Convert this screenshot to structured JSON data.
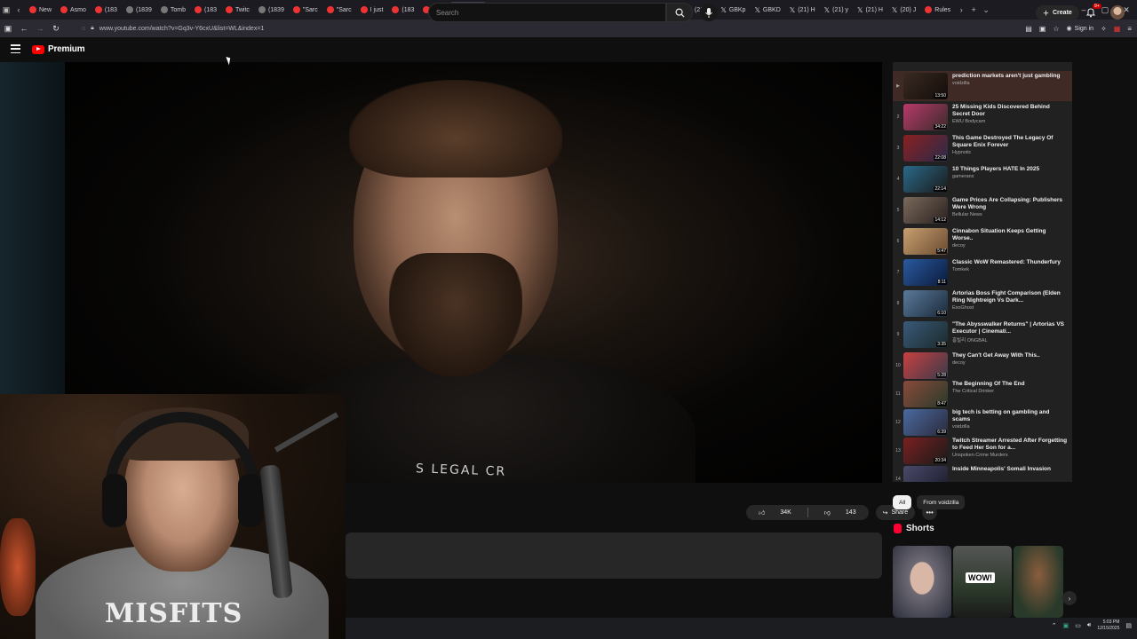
{
  "browser": {
    "tabs": [
      {
        "label": "New",
        "icon": "red"
      },
      {
        "label": "Asmo",
        "icon": "red"
      },
      {
        "label": "(183",
        "icon": "red"
      },
      {
        "label": "(1839",
        "icon": "gray"
      },
      {
        "label": "Tomb",
        "icon": "gray"
      },
      {
        "label": "(183",
        "icon": "red"
      },
      {
        "label": "Twitc",
        "icon": "red"
      },
      {
        "label": "(1839",
        "icon": "gray"
      },
      {
        "label": "\"Sarc",
        "icon": "red"
      },
      {
        "label": "\"Sarc",
        "icon": "red"
      },
      {
        "label": "I just",
        "icon": "red"
      },
      {
        "label": "(183",
        "icon": "red"
      },
      {
        "label": "(183",
        "icon": "red"
      },
      {
        "label": "(1)",
        "icon": "red",
        "active": true
      },
      {
        "label": "(183",
        "icon": "red"
      },
      {
        "label": "(183",
        "icon": "red"
      },
      {
        "label": "Hois",
        "icon": "red"
      },
      {
        "label": "(21) F",
        "icon": "x"
      },
      {
        "label": "(21) E",
        "icon": "x"
      },
      {
        "label": "(21) T",
        "icon": "x"
      },
      {
        "label": "(21) H",
        "icon": "x"
      },
      {
        "label": "GBKp",
        "icon": "x"
      },
      {
        "label": "GBKD",
        "icon": "x"
      },
      {
        "label": "(21) H",
        "icon": "x"
      },
      {
        "label": "(21) y",
        "icon": "x"
      },
      {
        "label": "(21) H",
        "icon": "x"
      },
      {
        "label": "(20) J",
        "icon": "x"
      },
      {
        "label": "Rules",
        "icon": "red"
      }
    ],
    "url": "www.youtube.com/watch?v=Gq3v-Y6cxU&list=WL&index=1",
    "signin": "Sign in"
  },
  "youtube": {
    "logo": "Premium",
    "search_placeholder": "Search",
    "create_label": "Create",
    "notif_badge": "9+"
  },
  "video": {
    "shirt_text": "S LEGAL CR",
    "likes": "34K",
    "dislikes": "143",
    "share_label": "Share"
  },
  "webcam": {
    "shirt_text": "MISFITS"
  },
  "playlist": {
    "items": [
      {
        "index": "▶",
        "title": "prediction markets aren't just gambling",
        "channel": "voidzilla",
        "duration": "13:50",
        "current": true
      },
      {
        "index": "2",
        "title": "25 Missing Kids Discovered Behind Secret Door",
        "channel": "EWU Bodycam",
        "duration": "34:22"
      },
      {
        "index": "3",
        "title": "This Game Destroyed The Legacy Of Square Enix Forever",
        "channel": "Hypnotic",
        "duration": "22:08"
      },
      {
        "index": "4",
        "title": "10 Things Players HATE In 2025",
        "channel": "gameranx",
        "duration": "22:14"
      },
      {
        "index": "5",
        "title": "Game Prices Are Collapsing: Publishers Were Wrong",
        "channel": "Bellular News",
        "duration": "14:12"
      },
      {
        "index": "6",
        "title": "Cinnabon Situation Keeps Getting Worse..",
        "channel": "decoy",
        "duration": "5:47"
      },
      {
        "index": "7",
        "title": "Classic WoW Remastered: Thunderfury",
        "channel": "Tomkek",
        "duration": "8:11"
      },
      {
        "index": "8",
        "title": "Artorias Boss Fight Comparison (Elden Ring Nightreign Vs Dark...",
        "channel": "ExoGhost",
        "duration": "6:10"
      },
      {
        "index": "9",
        "title": "\"The Abysswalker Returns\" | Artorias VS Executor | Cinemati...",
        "channel": "흥빌리 ONGBAL",
        "duration": "3:35"
      },
      {
        "index": "10",
        "title": "They Can't Get Away With This..",
        "channel": "decoy",
        "duration": "5:28"
      },
      {
        "index": "11",
        "title": "The Beginning Of The End",
        "channel": "The Critical Drinker",
        "duration": "8:47"
      },
      {
        "index": "12",
        "title": "big tech is betting on gambling and scams",
        "channel": "voidzilla",
        "duration": "6:39"
      },
      {
        "index": "13",
        "title": "Twitch Streamer Arrested After Forgetting to Feed Her Son for a...",
        "channel": "Unspoken Crime Murders",
        "duration": "20:34"
      },
      {
        "index": "14",
        "title": "Inside Minneapolis' Somali Invasion",
        "channel": "",
        "duration": ""
      }
    ]
  },
  "chips": {
    "all": "All",
    "from": "From voidzilla"
  },
  "shorts": {
    "heading": "Shorts",
    "wow_text": "WOW!"
  },
  "taskbar": {
    "time": "5:03 PM",
    "date": "12/15/2025"
  }
}
